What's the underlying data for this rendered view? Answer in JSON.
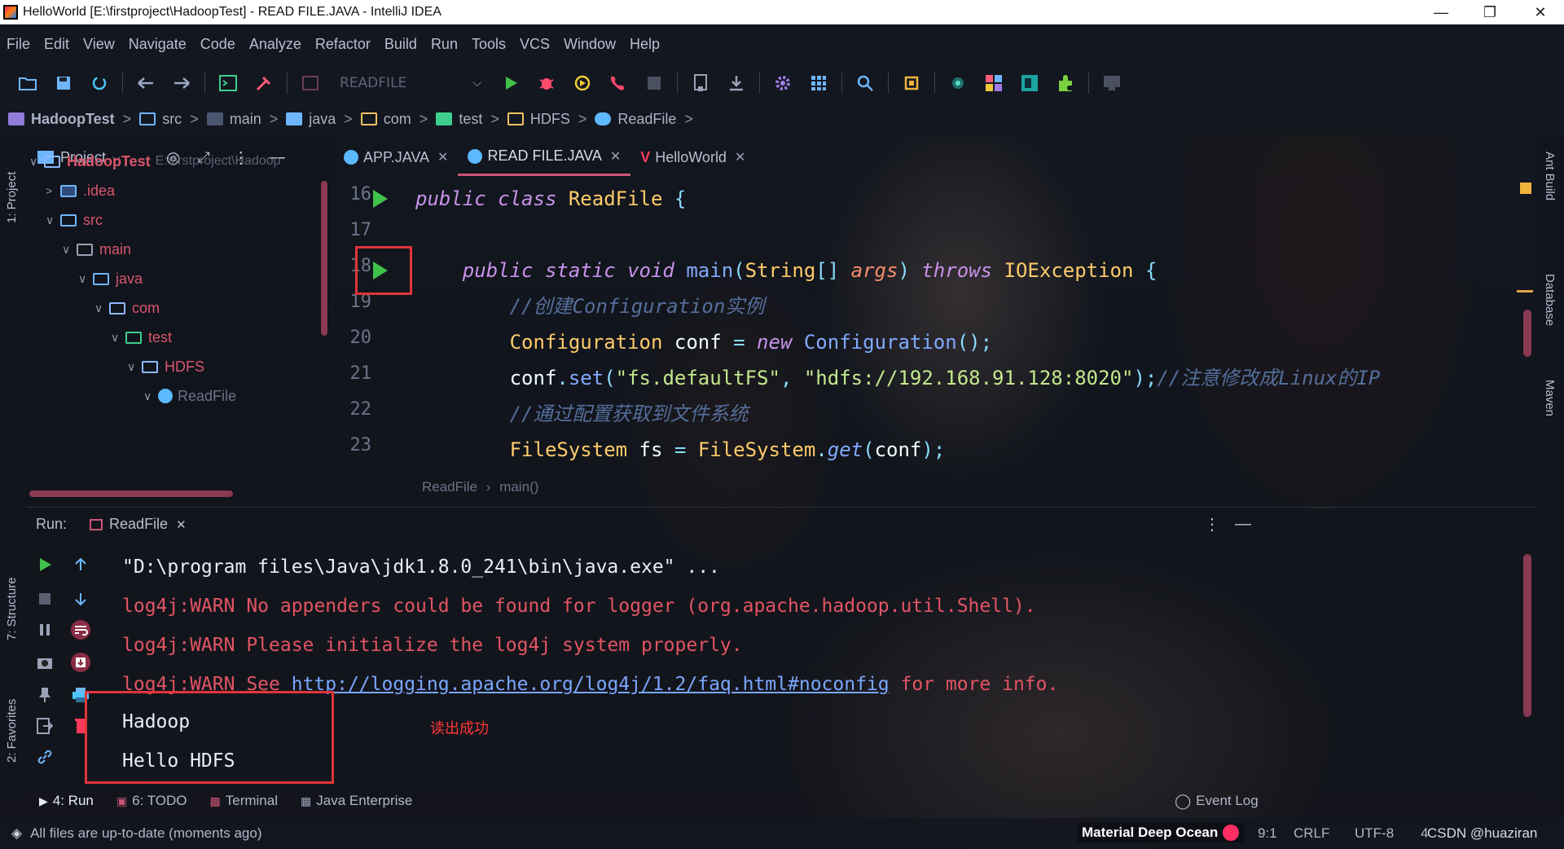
{
  "window": {
    "title": "HelloWorld [E:\\firstproject\\HadoopTest] - READ FILE.JAVA - IntelliJ IDEA",
    "controls": [
      "—",
      "❐",
      "✕"
    ]
  },
  "menu": [
    {
      "label": "File"
    },
    {
      "label": "Edit"
    },
    {
      "label": "View"
    },
    {
      "label": "Navigate"
    },
    {
      "label": "Code"
    },
    {
      "label": "Analyze"
    },
    {
      "label": "Refactor"
    },
    {
      "label": "Build"
    },
    {
      "label": "Run"
    },
    {
      "label": "Tools"
    },
    {
      "label": "VCS"
    },
    {
      "label": "Window"
    },
    {
      "label": "Help"
    }
  ],
  "toolbar": {
    "run_config": "READFILE",
    "icons": [
      "open-icon",
      "save-icon",
      "sync-icon",
      "back-icon",
      "forward-icon",
      "terminal-icon",
      "hammer-icon",
      "config-icon",
      "run-icon",
      "debug-icon",
      "coverage-icon",
      "profile-icon",
      "stop-icon",
      "sdk-icon",
      "download-icon",
      "settings-icon",
      "structure-icon",
      "search-icon",
      "plugin-icon",
      "vcs-icon",
      "layout-icon",
      "database-icon",
      "extension-icon",
      "presentation-icon"
    ]
  },
  "breadcrumb": [
    {
      "label": "HadoopTest",
      "color": "#8f7cd8"
    },
    {
      "label": "src",
      "color": "#6fb6ff"
    },
    {
      "label": "main",
      "color": "#8fb8ff"
    },
    {
      "label": "java",
      "color": "#6fb6ff"
    },
    {
      "label": "com",
      "color": "#f0c060"
    },
    {
      "label": "test",
      "color": "#3ecf8e"
    },
    {
      "label": "HDFS",
      "color": "#f0c060"
    },
    {
      "label": "ReadFile",
      "color": "#5cb8ff"
    }
  ],
  "left_stripe": {
    "project_tab": "1: Project",
    "structure_tab": "7: Structure",
    "favorites_tab": "2: Favorites"
  },
  "right_stripe": {
    "ant_tab": "Ant Build",
    "database_tab": "Database",
    "maven_tab": "Maven"
  },
  "project": {
    "header": "Project",
    "tree": [
      {
        "label": "HadoopTest",
        "path": "E:\\firstproject\\Hadoop",
        "indent": 0,
        "bold": true
      },
      {
        "label": ".idea",
        "indent": 1
      },
      {
        "label": "src",
        "indent": 1
      },
      {
        "label": "main",
        "indent": 2
      },
      {
        "label": "java",
        "indent": 3
      },
      {
        "label": "com",
        "indent": 4
      },
      {
        "label": "test",
        "indent": 5
      },
      {
        "label": "HDFS",
        "indent": 6
      },
      {
        "label": "ReadFile",
        "indent": 7
      }
    ]
  },
  "editor": {
    "tabs": [
      {
        "label": "APP.JAVA",
        "active": false
      },
      {
        "label": "READ FILE.JAVA",
        "active": true
      },
      {
        "label": "HelloWorld",
        "active": false
      }
    ],
    "line_numbers": [
      "16",
      "17",
      "18",
      "19",
      "20",
      "21",
      "22",
      "23"
    ],
    "code_crumb": [
      "ReadFile",
      "main()"
    ]
  },
  "run": {
    "label": "Run:",
    "tab": "ReadFile",
    "console": [
      {
        "text": "\"D:\\program files\\Java\\jdk1.8.0_241\\bin\\java.exe\" ...",
        "kind": "white"
      },
      {
        "text": "log4j:WARN No appenders could be found for logger (org.apache.hadoop.util.Shell).",
        "kind": "red"
      },
      {
        "text": "log4j:WARN Please initialize the log4j system properly.",
        "kind": "red"
      },
      {
        "text_a": "log4j:WARN See ",
        "link": "http://logging.apache.org/log4j/1.2/faq.html#noconfig",
        "text_b": " for more info.",
        "kind": "red"
      },
      {
        "text": "Hadoop",
        "kind": "white"
      },
      {
        "text": "Hello HDFS",
        "kind": "white"
      }
    ],
    "annotation": "读出成功"
  },
  "tool_tabs": [
    {
      "label": "4: Run"
    },
    {
      "label": "6: TODO"
    },
    {
      "label": "Terminal"
    },
    {
      "label": "Java Enterprise"
    }
  ],
  "event_log": "Event Log",
  "status": {
    "message": "All files are up-to-date (moments ago)",
    "theme": "Material Deep Ocean",
    "position": "9:1",
    "line_sep": "CRLF",
    "encoding": "UTF-8",
    "extra": "4",
    "watermark": "CSDN @huaziran"
  },
  "colors": {
    "accent": "#cc5577",
    "run_green": "#3fc14b",
    "highlight_red": "#e0353b"
  }
}
